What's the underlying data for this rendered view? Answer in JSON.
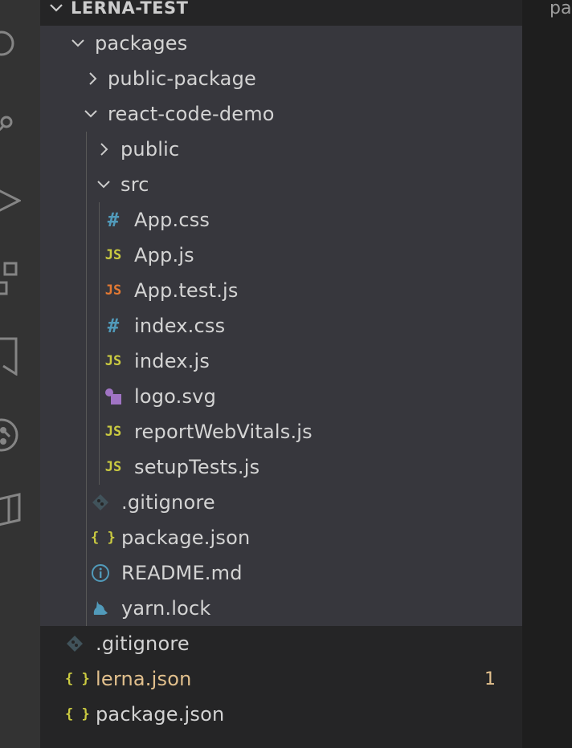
{
  "activity_bar": {
    "icons": [
      "explorer-icon",
      "source-control-icon",
      "run-debug-icon",
      "extensions-icon",
      "bookmarks-icon",
      "git-graph-icon",
      "package-icon"
    ]
  },
  "editor": {
    "tab_fragment": "pa"
  },
  "explorer": {
    "section_title": "LERNA-TEST",
    "tree": [
      {
        "label": "packages",
        "kind": "folder-open"
      },
      {
        "label": "public-package",
        "kind": "folder-closed"
      },
      {
        "label": "react-code-demo",
        "kind": "folder-open"
      },
      {
        "label": "public",
        "kind": "folder-closed"
      },
      {
        "label": "src",
        "kind": "folder-open"
      },
      {
        "label": "App.css",
        "kind": "css"
      },
      {
        "label": "App.js",
        "kind": "js"
      },
      {
        "label": "App.test.js",
        "kind": "test-js"
      },
      {
        "label": "index.css",
        "kind": "css"
      },
      {
        "label": "index.js",
        "kind": "js"
      },
      {
        "label": "logo.svg",
        "kind": "svg"
      },
      {
        "label": "reportWebVitals.js",
        "kind": "js"
      },
      {
        "label": "setupTests.js",
        "kind": "js"
      },
      {
        "label": ".gitignore",
        "kind": "git"
      },
      {
        "label": "package.json",
        "kind": "json"
      },
      {
        "label": "README.md",
        "kind": "info"
      },
      {
        "label": "yarn.lock",
        "kind": "yarn"
      },
      {
        "label": ".gitignore",
        "kind": "git"
      },
      {
        "label": "lerna.json",
        "kind": "json",
        "badge": "1"
      },
      {
        "label": "package.json",
        "kind": "json"
      }
    ]
  },
  "icon_glyphs": {
    "css": "#",
    "js": "JS",
    "test-js": "JS",
    "json": "{ }"
  },
  "colors": {
    "js": "#cbcb41",
    "test-js": "#e37933",
    "css": "#519aba",
    "svg": "#a074c4",
    "info": "#519aba",
    "yarn": "#519aba",
    "git": "#41535b",
    "json": "#cbcb41",
    "warning": "#e2c08d"
  }
}
